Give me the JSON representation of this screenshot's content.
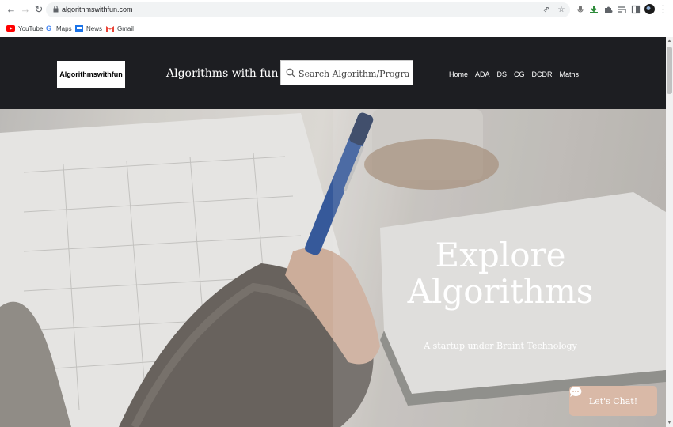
{
  "browser": {
    "url": "algorithmswithfun.com",
    "bookmarks": [
      {
        "label": "YouTube",
        "icon": "youtube-icon"
      },
      {
        "label": "Maps",
        "icon": "google-icon"
      },
      {
        "label": "News",
        "icon": "news-icon"
      },
      {
        "label": "Gmail",
        "icon": "gmail-icon"
      }
    ]
  },
  "header": {
    "logo_text": "Algorithmswithfun",
    "site_title": "Algorithms with fun",
    "search_placeholder": "Search Algorithm/Program",
    "nav": [
      "Home",
      "ADA",
      "DS",
      "CG",
      "DCDR",
      "Maths"
    ]
  },
  "hero": {
    "heading_line1": "Explore",
    "heading_line2": "Algorithms",
    "subtitle": "A startup under Braint Technology"
  },
  "chat": {
    "label": "Let's Chat!"
  },
  "colors": {
    "header_bg": "#1d1e22",
    "chat_button_bg": "#d9b9a7",
    "hero_text": "#ffffff"
  }
}
